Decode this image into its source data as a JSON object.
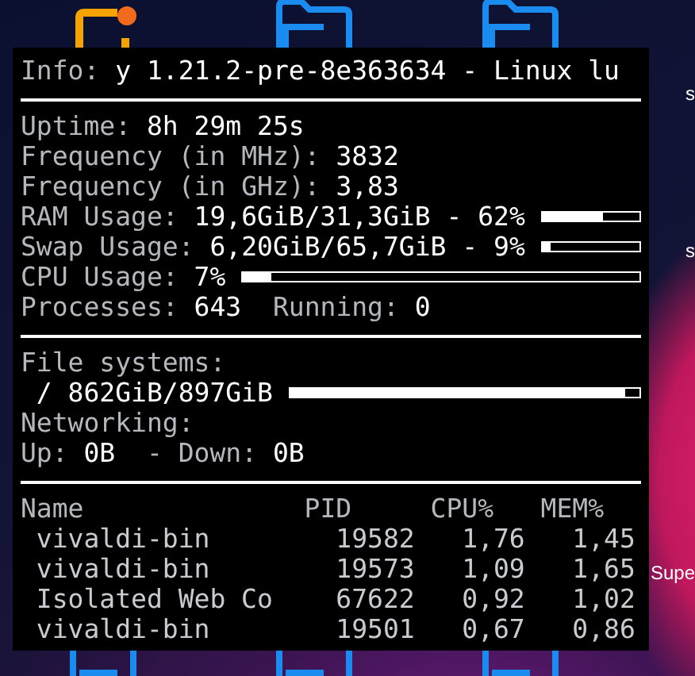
{
  "desktop_labels": [
    "s",
    "s",
    "Supe"
  ],
  "info": {
    "label": "Info:",
    "value": "y 1.21.2-pre-8e363634 - Linux lu"
  },
  "stats": [
    {
      "kind": "text",
      "fields": [
        {
          "label": "Uptime:",
          "value": "8h 29m 25s"
        }
      ]
    },
    {
      "kind": "text",
      "fields": [
        {
          "label": "Frequency (in MHz):",
          "value": "3832"
        }
      ]
    },
    {
      "kind": "text",
      "fields": [
        {
          "label": "Frequency (in GHz):",
          "value": "3,83"
        }
      ]
    },
    {
      "kind": "bar",
      "fields": [
        {
          "label": "RAM Usage:",
          "value": "19,6GiB/31,3GiB - 62%"
        }
      ],
      "level": 0.62
    },
    {
      "kind": "bar",
      "fields": [
        {
          "label": "Swap Usage:",
          "value": "6,20GiB/65,7GiB - 9%"
        }
      ],
      "level": 0.09
    },
    {
      "kind": "bar",
      "fields": [
        {
          "label": "CPU Usage:",
          "value": "7%"
        }
      ],
      "level": 0.07
    },
    {
      "kind": "text",
      "fields": [
        {
          "label": "Processes:",
          "value": "643"
        },
        {
          "label": "Running:",
          "value": "0"
        }
      ]
    }
  ],
  "file_systems": {
    "heading": "File systems:",
    "mounts": [
      {
        "path": "/",
        "usage": "862GiB/897GiB",
        "level": 0.96
      }
    ]
  },
  "networking": {
    "heading": "Networking:",
    "fields": [
      {
        "label": "Up:",
        "value": "0B"
      },
      {
        "label": "- Down:",
        "value": "0B"
      }
    ]
  },
  "processes": {
    "columns": [
      "Name",
      "PID",
      "CPU%",
      "MEM%"
    ],
    "rows": [
      [
        "vivaldi-bin",
        "19582",
        "1,76",
        "1,45"
      ],
      [
        "vivaldi-bin",
        "19573",
        "1,09",
        "1,65"
      ],
      [
        "Isolated Web Co",
        "67622",
        "0,92",
        "1,02"
      ],
      [
        "vivaldi-bin",
        "19501",
        "0,67",
        "0,86"
      ]
    ]
  }
}
